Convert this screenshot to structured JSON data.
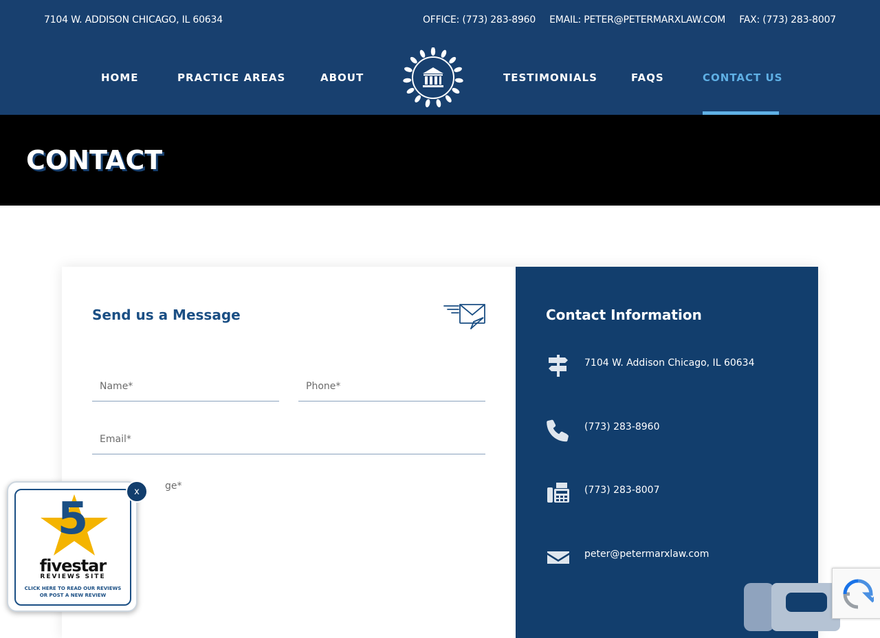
{
  "topbar": {
    "address": "7104 W. ADDISON CHICAGO, IL 60634",
    "office": "OFFICE: (773) 283-8960",
    "email": "EMAIL: PETER@PETERMARXLAW.COM",
    "fax": "FAX: (773) 283-8007"
  },
  "nav": {
    "items": [
      {
        "label": "HOME"
      },
      {
        "label": "PRACTICE AREAS"
      },
      {
        "label": "ABOUT"
      },
      {
        "label": "TESTIMONIALS"
      },
      {
        "label": "FAQS"
      },
      {
        "label": "CONTACT US"
      }
    ],
    "active": "CONTACT US",
    "logo_icon": "courthouse-laurel-logo"
  },
  "hero": {
    "title": "CONTACT"
  },
  "form": {
    "title": "Send us a Message",
    "name_placeholder": "Name*",
    "phone_placeholder": "Phone*",
    "email_placeholder": "Email*",
    "message_label": "ge*",
    "icon": "envelope-send-icon"
  },
  "info": {
    "title": "Contact Information",
    "rows": [
      {
        "icon": "signpost-icon",
        "text": "7104 W. Addison Chicago, IL 60634"
      },
      {
        "icon": "phone-icon",
        "text": "(773) 283-8960"
      },
      {
        "icon": "fax-icon",
        "text": "(773) 283-8007"
      },
      {
        "icon": "envelope-icon",
        "text": "peter@petermarxlaw.com"
      }
    ]
  },
  "badge": {
    "close": "x",
    "number": "5",
    "brand": "fivestar",
    "site": "REVIEWS SITE",
    "cta_line1": "CLICK HERE TO READ OUR REVIEWS",
    "cta_line2": "OR POST A NEW REVIEW"
  },
  "colors": {
    "navy": "#18406f",
    "info_bg": "#123e6d",
    "accent": "#5fb0e5",
    "title_blue": "#1b4f84"
  }
}
